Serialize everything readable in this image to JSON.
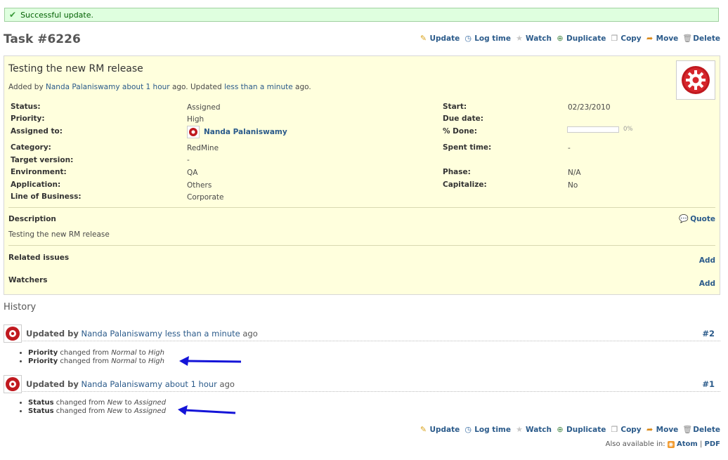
{
  "flash": {
    "message": "Successful update."
  },
  "page": {
    "title": "Task #6226"
  },
  "actions": {
    "update": "Update",
    "log_time": "Log time",
    "watch": "Watch",
    "duplicate": "Duplicate",
    "copy": "Copy",
    "move": "Move",
    "delete": "Delete"
  },
  "issue": {
    "subject": "Testing the new RM release",
    "added_by_prefix": "Added by",
    "author": "Nanda Palaniswamy",
    "added_ago": "about 1 hour",
    "updated_mid": "ago. Updated",
    "updated_ago": "less than a minute",
    "updated_suffix": "ago.",
    "attrs_left": [
      {
        "label": "Status:",
        "value": "Assigned"
      },
      {
        "label": "Priority:",
        "value": "High"
      },
      {
        "label": "Assigned to:",
        "value": "Nanda Palaniswamy"
      },
      {
        "label": "Category:",
        "value": "RedMine"
      },
      {
        "label": "Target version:",
        "value": "-"
      },
      {
        "label": "Environment:",
        "value": "QA"
      },
      {
        "label": "Application:",
        "value": "Others"
      },
      {
        "label": "Line of Business:",
        "value": "Corporate"
      }
    ],
    "attrs_right": [
      {
        "label": "Start:",
        "value": "02/23/2010"
      },
      {
        "label": "Due date:",
        "value": ""
      },
      {
        "label": "% Done:",
        "value": "0%"
      },
      {
        "label": "Spent time:",
        "value": "-"
      },
      {
        "label": "Phase:",
        "value": "N/A"
      },
      {
        "label": "Capitalize:",
        "value": "No"
      }
    ],
    "done_ratio": 0,
    "description_label": "Description",
    "quote_label": "Quote",
    "description": "Testing the new RM release",
    "related_label": "Related issues",
    "watchers_label": "Watchers",
    "add_label": "Add"
  },
  "history": {
    "title": "History",
    "journals": [
      {
        "prefix": "Updated by",
        "author": "Nanda Palaniswamy",
        "ago": "less than a minute",
        "suffix": "ago",
        "number": "#2",
        "details": [
          {
            "field": "Priority",
            "changed": "changed from",
            "old": "Normal",
            "to": "to",
            "new": "High"
          },
          {
            "field": "Priority",
            "changed": "changed from",
            "old": "Normal",
            "to": "to",
            "new": "High"
          }
        ]
      },
      {
        "prefix": "Updated by",
        "author": "Nanda Palaniswamy",
        "ago": "about 1 hour",
        "suffix": "ago",
        "number": "#1",
        "details": [
          {
            "field": "Status",
            "changed": "changed from",
            "old": "New",
            "to": "to",
            "new": "Assigned"
          },
          {
            "field": "Status",
            "changed": "changed from",
            "old": "New",
            "to": "to",
            "new": "Assigned"
          }
        ]
      }
    ]
  },
  "footer": {
    "also_available": "Also available in:",
    "atom": "Atom",
    "sep": "|",
    "pdf": "PDF"
  },
  "colors": {
    "accent": "#2a5a8a",
    "issue_bg": "#ffffdd",
    "flash_bg": "#dfffdf",
    "arrow": "#1414d8"
  },
  "icons": [
    "check-icon",
    "pencil-icon",
    "clock-icon",
    "star-icon",
    "duplicate-icon",
    "copy-icon",
    "move-icon",
    "trash-icon",
    "gear-avatar-icon",
    "quote-icon",
    "rss-icon",
    "arrow-icon"
  ]
}
